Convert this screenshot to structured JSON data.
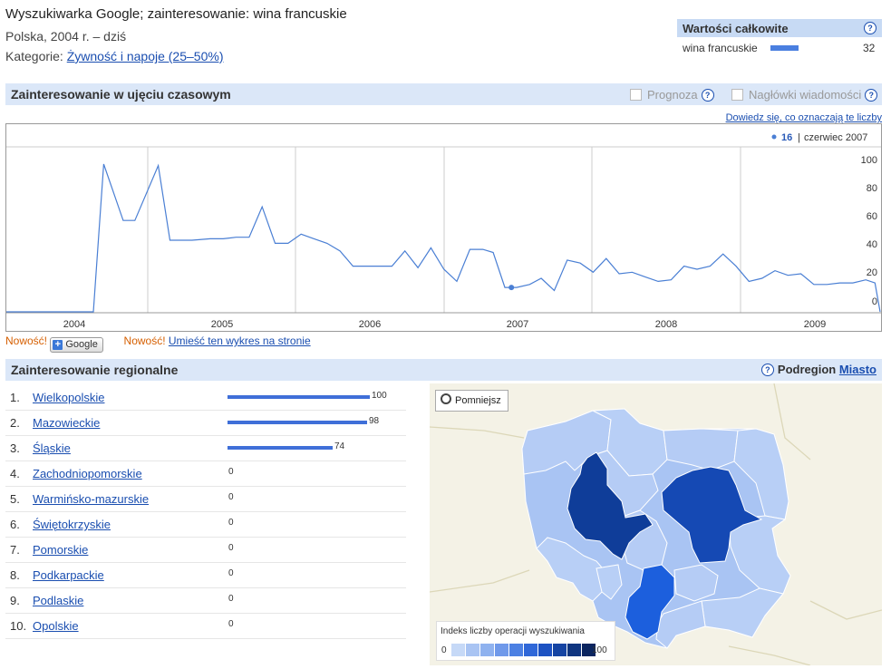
{
  "header": {
    "title": "Wyszukiwarka Google; zainteresowanie: wina francuskie",
    "subtitle": "Polska, 2004 r. – dziś",
    "category_label": "Kategorie:",
    "category_link": "Żywność i napoje (25–50%)"
  },
  "totals": {
    "title": "Wartości całkowite",
    "term": "wina francuskie",
    "value": "32",
    "bar_fraction": 0.32
  },
  "timeline": {
    "title": "Zainteresowanie w ujęciu czasowym",
    "forecast_label": "Prognoza",
    "news_label": "Nagłówki wiadomości",
    "learn_link": "Dowiedz się, co oznaczają te liczby",
    "tooltip_value": "16",
    "tooltip_date": "czerwiec 2007"
  },
  "news_row": {
    "new1": "Nowość!",
    "google_button": "Google",
    "new2": "Nowość!",
    "embed_link": "Umieść ten wykres na stronie"
  },
  "chart_data": {
    "type": "line",
    "x_tick_labels": [
      "2004",
      "2005",
      "2006",
      "2007",
      "2008",
      "2009"
    ],
    "y_ticks": [
      0,
      20,
      40,
      60,
      80,
      100
    ],
    "ylim": [
      0,
      100
    ],
    "xlim": [
      2004.0,
      2009.85
    ],
    "grid": true,
    "highlight": {
      "x": 2007.46,
      "y": 16
    },
    "series": [
      {
        "color": "#4a7fd4",
        "points": [
          [
            2003.93,
            0
          ],
          [
            2004.6,
            0
          ],
          [
            2004.68,
            97
          ],
          [
            2004.83,
            60
          ],
          [
            2004.92,
            60
          ],
          [
            2005.1,
            96
          ],
          [
            2005.19,
            47
          ],
          [
            2005.36,
            47
          ],
          [
            2005.5,
            48
          ],
          [
            2005.6,
            48
          ],
          [
            2005.7,
            49
          ],
          [
            2005.8,
            49
          ],
          [
            2005.9,
            69
          ],
          [
            2006.0,
            45
          ],
          [
            2006.1,
            45
          ],
          [
            2006.2,
            51
          ],
          [
            2006.3,
            48
          ],
          [
            2006.4,
            45
          ],
          [
            2006.5,
            40
          ],
          [
            2006.6,
            30
          ],
          [
            2006.7,
            30
          ],
          [
            2006.8,
            30
          ],
          [
            2006.9,
            30
          ],
          [
            2007.0,
            40
          ],
          [
            2007.1,
            29
          ],
          [
            2007.2,
            42
          ],
          [
            2007.3,
            28
          ],
          [
            2007.4,
            20
          ],
          [
            2007.5,
            41
          ],
          [
            2007.6,
            41
          ],
          [
            2007.68,
            39
          ],
          [
            2007.77,
            16
          ],
          [
            2007.86,
            16
          ],
          [
            2007.96,
            18
          ],
          [
            2008.05,
            22
          ],
          [
            2008.15,
            14
          ],
          [
            2008.25,
            34
          ],
          [
            2008.35,
            32
          ],
          [
            2008.45,
            26
          ],
          [
            2008.55,
            35
          ],
          [
            2008.65,
            25
          ],
          [
            2008.75,
            26
          ],
          [
            2008.85,
            23
          ],
          [
            2008.95,
            20
          ],
          [
            2009.05,
            21
          ],
          [
            2009.15,
            30
          ],
          [
            2009.25,
            28
          ],
          [
            2009.35,
            30
          ],
          [
            2009.45,
            38
          ],
          [
            2009.55,
            30
          ],
          [
            2009.65,
            20
          ],
          [
            2009.75,
            22
          ],
          [
            2009.85,
            27
          ],
          [
            2009.95,
            24
          ],
          [
            2010.05,
            25
          ],
          [
            2010.15,
            18
          ],
          [
            2010.25,
            18
          ],
          [
            2010.35,
            19
          ],
          [
            2010.45,
            19
          ],
          [
            2010.55,
            21
          ],
          [
            2010.62,
            19
          ],
          [
            2010.66,
            0
          ]
        ]
      }
    ]
  },
  "regional": {
    "title": "Zainteresowanie regionalne",
    "subregion_label": "Podregion",
    "city_link": "Miasto",
    "rows": [
      {
        "num": "1.",
        "name": "Wielkopolskie",
        "value": "100",
        "fraction": 1.0
      },
      {
        "num": "2.",
        "name": "Mazowieckie",
        "value": "98",
        "fraction": 0.98
      },
      {
        "num": "3.",
        "name": "Śląskie",
        "value": "74",
        "fraction": 0.74
      },
      {
        "num": "4.",
        "name": "Zachodniopomorskie",
        "value": "0",
        "fraction": 0
      },
      {
        "num": "5.",
        "name": "Warmińsko-mazurskie",
        "value": "0",
        "fraction": 0
      },
      {
        "num": "6.",
        "name": "Świętokrzyskie",
        "value": "0",
        "fraction": 0
      },
      {
        "num": "7.",
        "name": "Pomorskie",
        "value": "0",
        "fraction": 0
      },
      {
        "num": "8.",
        "name": "Podkarpackie",
        "value": "0",
        "fraction": 0
      },
      {
        "num": "9.",
        "name": "Podlaskie",
        "value": "0",
        "fraction": 0
      },
      {
        "num": "10.",
        "name": "Opolskie",
        "value": "0",
        "fraction": 0
      }
    ]
  },
  "map": {
    "zoom_out_label": "Pomniejsz",
    "legend_title": "Indeks liczby operacji wyszukiwania",
    "legend_min": "0",
    "legend_max": "100",
    "scale_colors": [
      "#c6d9f7",
      "#a9c4f3",
      "#8fb2ef",
      "#6f99ea",
      "#4c80e3",
      "#2f67d8",
      "#1d52c2",
      "#1544a3",
      "#0f3580",
      "#0a2560"
    ]
  }
}
